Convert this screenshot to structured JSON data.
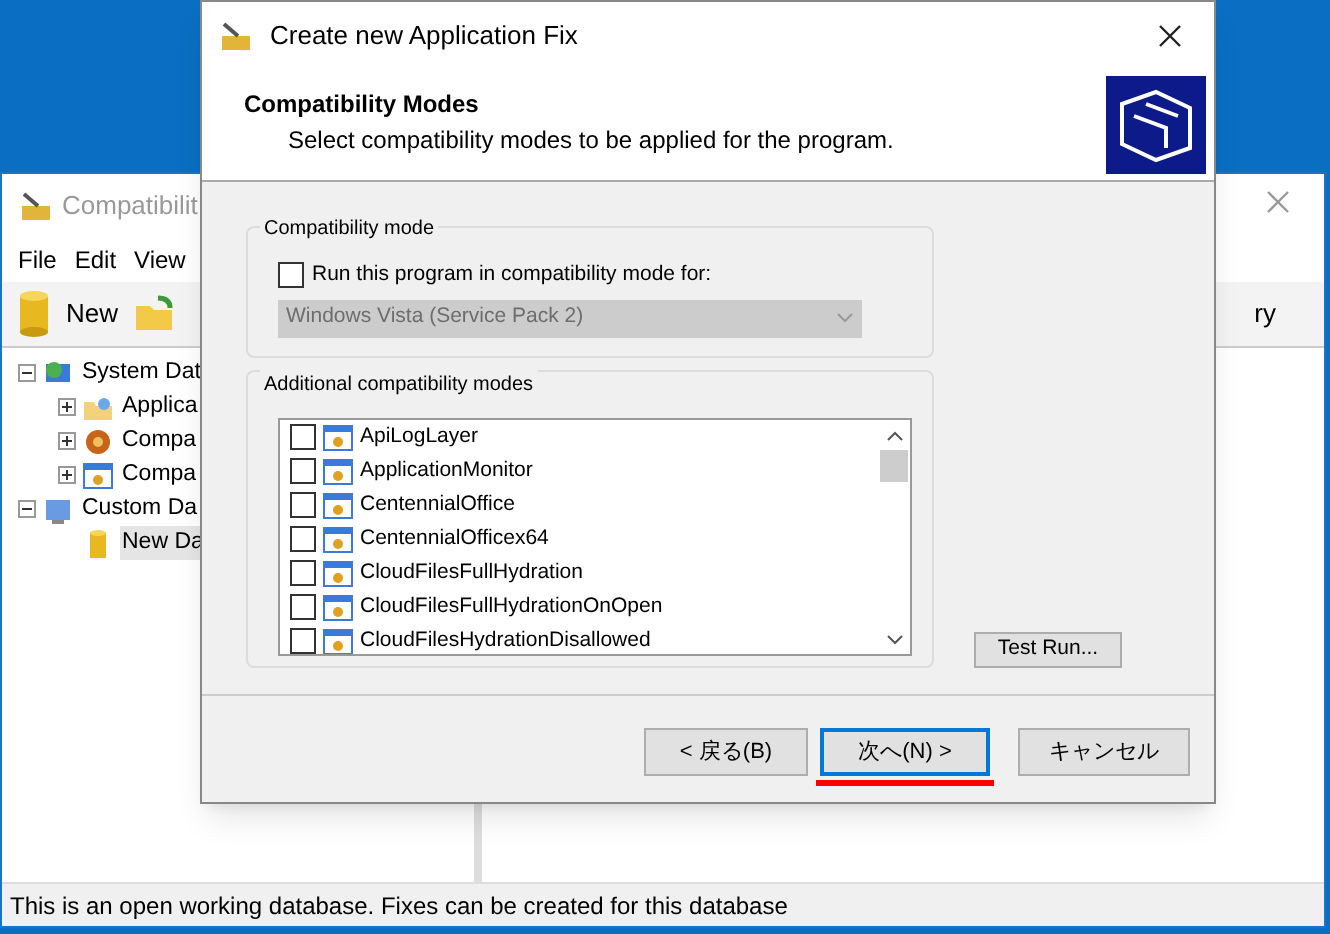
{
  "app_window": {
    "title": "Compatibilit",
    "menu": [
      "File",
      "Edit",
      "View"
    ],
    "toolbar": [
      {
        "kind": "new",
        "label": "New"
      },
      {
        "kind": "open"
      }
    ],
    "right_toolbar_text": "ry",
    "tree": [
      {
        "kind": "system",
        "label": "System Dat",
        "expanded": true,
        "children": [
          {
            "kind": "apps",
            "label": "Applica",
            "expanded": false
          },
          {
            "kind": "gear",
            "label": "Compa",
            "expanded": false
          },
          {
            "kind": "window",
            "label": "Compa",
            "expanded": false
          }
        ]
      },
      {
        "kind": "custom",
        "label": "Custom Da",
        "expanded": true,
        "children": [
          {
            "kind": "db",
            "label": "New Da",
            "selected": true
          }
        ]
      }
    ],
    "status_bar": "This is an open working database. Fixes can be created for this database"
  },
  "dialog": {
    "title": "Create new Application Fix",
    "heading": "Compatibility Modes",
    "subheading": "Select compatibility modes to be applied for the program.",
    "compat_group": {
      "title": "Compatibility mode",
      "checkbox": {
        "label": "Run this program in compatibility mode for:",
        "checked": false
      },
      "dropdown": {
        "value": "Windows Vista (Service Pack 2)",
        "disabled": true
      }
    },
    "additional_group": {
      "title": "Additional compatibility modes",
      "items": [
        {
          "label": "ApiLogLayer",
          "checked": false
        },
        {
          "label": "ApplicationMonitor",
          "checked": false
        },
        {
          "label": "CentennialOffice",
          "checked": false
        },
        {
          "label": "CentennialOfficex64",
          "checked": false
        },
        {
          "label": "CloudFilesFullHydration",
          "checked": false
        },
        {
          "label": "CloudFilesFullHydrationOnOpen",
          "checked": false
        },
        {
          "label": "CloudFilesHydrationDisallowed",
          "checked": false
        }
      ]
    },
    "test_run": "Test Run...",
    "buttons": [
      {
        "label": "< 戻る(B)",
        "default": false
      },
      {
        "label": "次へ(N) >",
        "default": true
      },
      {
        "label": "キャンセル",
        "default": false
      }
    ]
  }
}
